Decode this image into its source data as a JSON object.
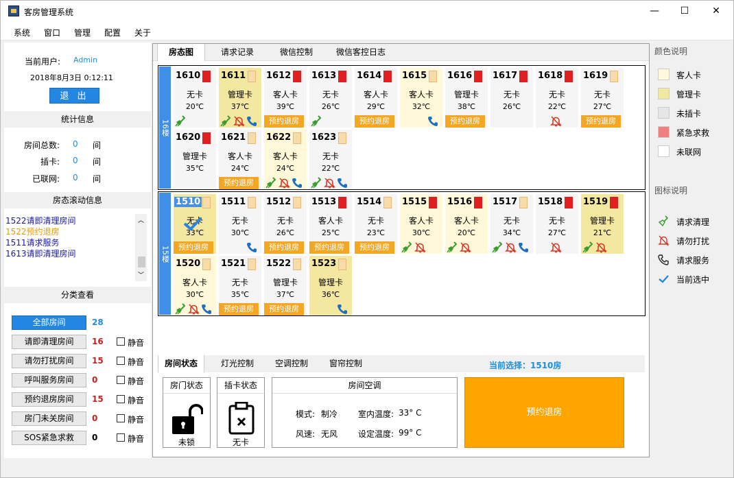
{
  "window": {
    "title": "客房管理系统",
    "min": "—",
    "max": "☐",
    "close": "✕"
  },
  "menu": [
    "系统",
    "窗口",
    "管理",
    "配置",
    "关于"
  ],
  "user": {
    "label": "当前用户:",
    "name": "Admin",
    "datetime": "2018年8月3日  0:12:11",
    "logout": "退 出"
  },
  "stats": {
    "header": "统计信息",
    "total_label": "房间总数:",
    "total": "0",
    "total_unit": "间",
    "card_label": "插卡:",
    "card": "0",
    "card_unit": "间",
    "net_label": "已联网:",
    "net": "0",
    "net_unit": "间"
  },
  "scroll": {
    "header": "房态滚动信息",
    "items": [
      {
        "text": "1522请即清理房间",
        "color": "#1a1aa8"
      },
      {
        "text": "1522预约退房",
        "color": "#e89a00"
      },
      {
        "text": "1511请求服务",
        "color": "#1a1aa8"
      },
      {
        "text": "1613请即清理房间",
        "color": "#1a1aa8"
      }
    ]
  },
  "category": {
    "header": "分类查看",
    "mute": "静音",
    "items": [
      {
        "label": "全部房间",
        "count": "28",
        "count_color": "#1d8fdc"
      },
      {
        "label": "请即清理房间",
        "count": "16",
        "count_color": "#cc2020"
      },
      {
        "label": "请勿打扰房间",
        "count": "15",
        "count_color": "#cc2020"
      },
      {
        "label": "呼叫服务房间",
        "count": "0",
        "count_color": "#cc2020"
      },
      {
        "label": "预约退房房间",
        "count": "15",
        "count_color": "#cc2020"
      },
      {
        "label": "房门未关房间",
        "count": "0",
        "count_color": "#cc2020"
      },
      {
        "label": "SOS紧急求救",
        "count": "0",
        "count_color": "#000000"
      }
    ]
  },
  "tabs": [
    "房态图",
    "请求记录",
    "微信控制",
    "微信客控日志"
  ],
  "floors": [
    {
      "label": "16楼",
      "rooms": [
        {
          "num": "1610",
          "cls": "none",
          "card": "red",
          "status": "无卡",
          "temp": "20℃",
          "checkout": false,
          "icons": [
            "clean"
          ]
        },
        {
          "num": "1611",
          "cls": "mgr",
          "card": "fr",
          "status": "管理卡",
          "temp": "37℃",
          "checkout": false,
          "icons": [
            "clean",
            "dnd",
            "service"
          ]
        },
        {
          "num": "1612",
          "cls": "none",
          "card": "red",
          "status": "客人卡",
          "temp": "39℃",
          "checkout": true,
          "icons": []
        },
        {
          "num": "1613",
          "cls": "none",
          "card": "red",
          "status": "无卡",
          "temp": "26℃",
          "checkout": false,
          "icons": [
            "clean"
          ]
        },
        {
          "num": "1614",
          "cls": "none",
          "card": "red",
          "status": "客人卡",
          "temp": "29℃",
          "checkout": true,
          "icons": []
        },
        {
          "num": "1615",
          "cls": "guest",
          "card": "fr",
          "status": "客人卡",
          "temp": "32℃",
          "checkout": false,
          "icons": [
            "",
            "",
            "service"
          ]
        },
        {
          "num": "1616",
          "cls": "none",
          "card": "red",
          "status": "管理卡",
          "temp": "38℃",
          "checkout": true,
          "icons": []
        },
        {
          "num": "1617",
          "cls": "none",
          "card": "red",
          "status": "无卡",
          "temp": "26℃",
          "checkout": false,
          "icons": []
        },
        {
          "num": "1618",
          "cls": "none",
          "card": "red",
          "status": "无卡",
          "temp": "22℃",
          "checkout": false,
          "icons": [
            "",
            "dnd"
          ]
        },
        {
          "num": "1619",
          "cls": "none",
          "card": "fr",
          "status": "无卡",
          "temp": "27℃",
          "checkout": true,
          "icons": []
        },
        {
          "num": "1620",
          "cls": "none",
          "card": "red",
          "status": "管理卡",
          "temp": "35℃",
          "checkout": false,
          "icons": []
        },
        {
          "num": "1621",
          "cls": "none",
          "card": "fr",
          "status": "客人卡",
          "temp": "24℃",
          "checkout": true,
          "icons": []
        },
        {
          "num": "1622",
          "cls": "guest",
          "card": "fr",
          "status": "客人卡",
          "temp": "24℃",
          "checkout": false,
          "icons": [
            "clean",
            "dnd",
            "service"
          ]
        },
        {
          "num": "1623",
          "cls": "none",
          "card": "fr",
          "status": "无卡",
          "temp": "22℃",
          "checkout": false,
          "icons": [
            "clean",
            "dnd",
            "service"
          ]
        }
      ]
    },
    {
      "label": "15楼",
      "rooms": [
        {
          "num": "1510",
          "cls": "sel",
          "card": "fr",
          "status": "无卡",
          "temp": "33℃",
          "checkout": true,
          "icons": [],
          "selected": true
        },
        {
          "num": "1511",
          "cls": "none",
          "card": "fr",
          "status": "无卡",
          "temp": "30℃",
          "checkout": false,
          "icons": [
            "",
            "",
            "service"
          ]
        },
        {
          "num": "1512",
          "cls": "none",
          "card": "fr",
          "status": "无卡",
          "temp": "26℃",
          "checkout": true,
          "icons": []
        },
        {
          "num": "1513",
          "cls": "none",
          "card": "red",
          "status": "客人卡",
          "temp": "25℃",
          "checkout": true,
          "icons": []
        },
        {
          "num": "1514",
          "cls": "none",
          "card": "fr",
          "status": "无卡",
          "temp": "23℃",
          "checkout": true,
          "icons": []
        },
        {
          "num": "1515",
          "cls": "guest",
          "card": "red",
          "status": "客人卡",
          "temp": "30℃",
          "checkout": false,
          "icons": [
            "clean",
            "dnd"
          ]
        },
        {
          "num": "1516",
          "cls": "guest",
          "card": "red",
          "status": "客人卡",
          "temp": "20℃",
          "checkout": false,
          "icons": [
            "clean",
            "dnd"
          ]
        },
        {
          "num": "1517",
          "cls": "none",
          "card": "fr",
          "status": "无卡",
          "temp": "34℃",
          "checkout": false,
          "icons": [
            "clean",
            "dnd",
            "service"
          ]
        },
        {
          "num": "1518",
          "cls": "none",
          "card": "red",
          "status": "无卡",
          "temp": "27℃",
          "checkout": false,
          "icons": [
            "",
            "dnd"
          ]
        },
        {
          "num": "1519",
          "cls": "mgr",
          "card": "red",
          "status": "管理卡",
          "temp": "21℃",
          "checkout": false,
          "icons": [
            "clean",
            "dnd"
          ]
        },
        {
          "num": "1520",
          "cls": "guest",
          "card": "fr",
          "status": "客人卡",
          "temp": "30℃",
          "checkout": false,
          "icons": [
            "clean",
            "dnd",
            "service"
          ]
        },
        {
          "num": "1521",
          "cls": "none",
          "card": "fr",
          "status": "无卡",
          "temp": "35℃",
          "checkout": true,
          "icons": []
        },
        {
          "num": "1522",
          "cls": "none",
          "card": "fr",
          "status": "管理卡",
          "temp": "37℃",
          "checkout": true,
          "icons": []
        },
        {
          "num": "1523",
          "cls": "mgr",
          "card": "fr",
          "status": "管理卡",
          "temp": "36℃",
          "checkout": false,
          "icons": [
            "",
            "",
            "service"
          ]
        }
      ]
    }
  ],
  "checkout_text": "预约退房",
  "bottom_tabs": [
    "房间状态",
    "灯光控制",
    "空调控制",
    "窗帘控制"
  ],
  "current_selection": "当前选择：1510房",
  "door": {
    "title": "房门状态",
    "state": "未锁"
  },
  "cardstat": {
    "title": "插卡状态",
    "state": "无卡"
  },
  "ac": {
    "title": "房间空调",
    "mode_label": "模式:",
    "mode": "制冷",
    "indoor_label": "室内温度:",
    "indoor": "33° C",
    "wind_label": "风速:",
    "wind": "无风",
    "set_label": "设定温度:",
    "set": "99° C"
  },
  "big_button": "预约退房",
  "legend": {
    "color_header": "颜色说明",
    "colors": [
      {
        "label": "客人卡",
        "color": "#fff9d9"
      },
      {
        "label": "管理卡",
        "color": "#f4e8a1"
      },
      {
        "label": "未插卡",
        "color": "#e6e6e6"
      },
      {
        "label": "紧急求救",
        "color": "#f08080"
      },
      {
        "label": "未联网",
        "color": "#ffffff"
      }
    ],
    "icon_header": "图标说明",
    "icons": [
      {
        "label": "请求清理",
        "icon": "broom-icon"
      },
      {
        "label": "请勿打扰",
        "icon": "bell-off-icon"
      },
      {
        "label": "请求服务",
        "icon": "phone-icon"
      },
      {
        "label": "当前选中",
        "icon": "checkmark-icon"
      }
    ]
  }
}
